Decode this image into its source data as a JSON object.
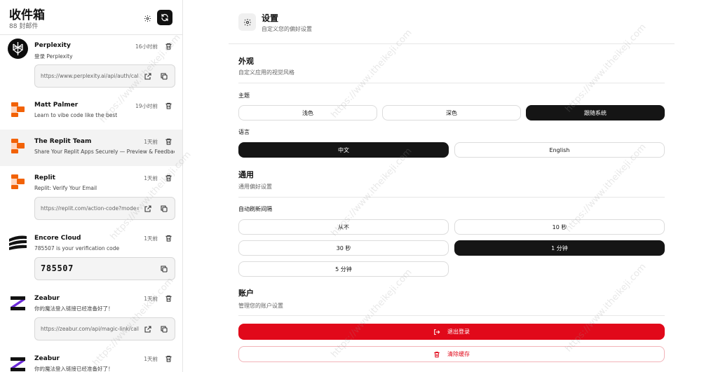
{
  "sidebar": {
    "title": "收件箱",
    "count": "88 封邮件"
  },
  "emails": [
    {
      "sender": "Perplexity",
      "time": "16小时前",
      "subject": "登录 Perplexity",
      "link": "https://www.perplexity.ai/api/auth/callback/email?callbackUrl=",
      "logo": "perplexity-logo"
    },
    {
      "sender": "Matt Palmer",
      "time": "19小时前",
      "subject": "Learn to vibe code like the best",
      "logo": "replit-logo"
    },
    {
      "sender": "The Replit Team",
      "time": "1天前",
      "subject": "Share Your Replit Apps Securely — Preview & Feedback Links",
      "logo": "replit-logo"
    },
    {
      "sender": "Replit",
      "time": "1天前",
      "subject": "Replit: Verify Your Email",
      "link": "https://replit.com/action-code?mode=verifyEmail",
      "logo": "replit-logo"
    },
    {
      "sender": "Encore Cloud",
      "time": "1天前",
      "subject": "785507 is your verification code",
      "code": "785507",
      "logo": "encore-logo"
    },
    {
      "sender": "Zeabur",
      "time": "1天前",
      "subject": "你的魔法登入链接已经准备好了！",
      "link": "https://zeabur.com/api/magic-link/callback?token=",
      "logo": "zeabur-logo"
    },
    {
      "sender": "Zeabur",
      "time": "1天前",
      "subject": "你的魔法登入链接已经准备好了！",
      "logo": "zeabur-logo"
    }
  ],
  "settings": {
    "title": "设置",
    "subtitle": "自定义您的偏好设置",
    "appearance": {
      "title": "外观",
      "subtitle": "自定义应用的视觉风格",
      "theme_label": "主题",
      "theme_options": [
        "浅色",
        "深色",
        "跟随系统"
      ],
      "theme_selected": "跟随系统",
      "language_label": "语言",
      "language_options": [
        "中文",
        "English"
      ],
      "language_selected": "中文"
    },
    "general": {
      "title": "通用",
      "subtitle": "通用偏好设置",
      "refresh_label": "自动刷新间隔",
      "refresh_options": [
        "从不",
        "10 秒",
        "30 秒",
        "1 分钟",
        "5 分钟"
      ],
      "refresh_selected": "1 分钟"
    },
    "account": {
      "title": "账户",
      "subtitle": "管理您的账户设置",
      "logout_label": "退出登录",
      "clear_cache_label": "清除缓存"
    }
  },
  "watermark": {
    "text1": "IT黑科技",
    "text2": "https://www.itheikeji.com"
  },
  "colors": {
    "danger": "#e1091a",
    "selected": "#151515",
    "replit_orange": "#f26207"
  }
}
